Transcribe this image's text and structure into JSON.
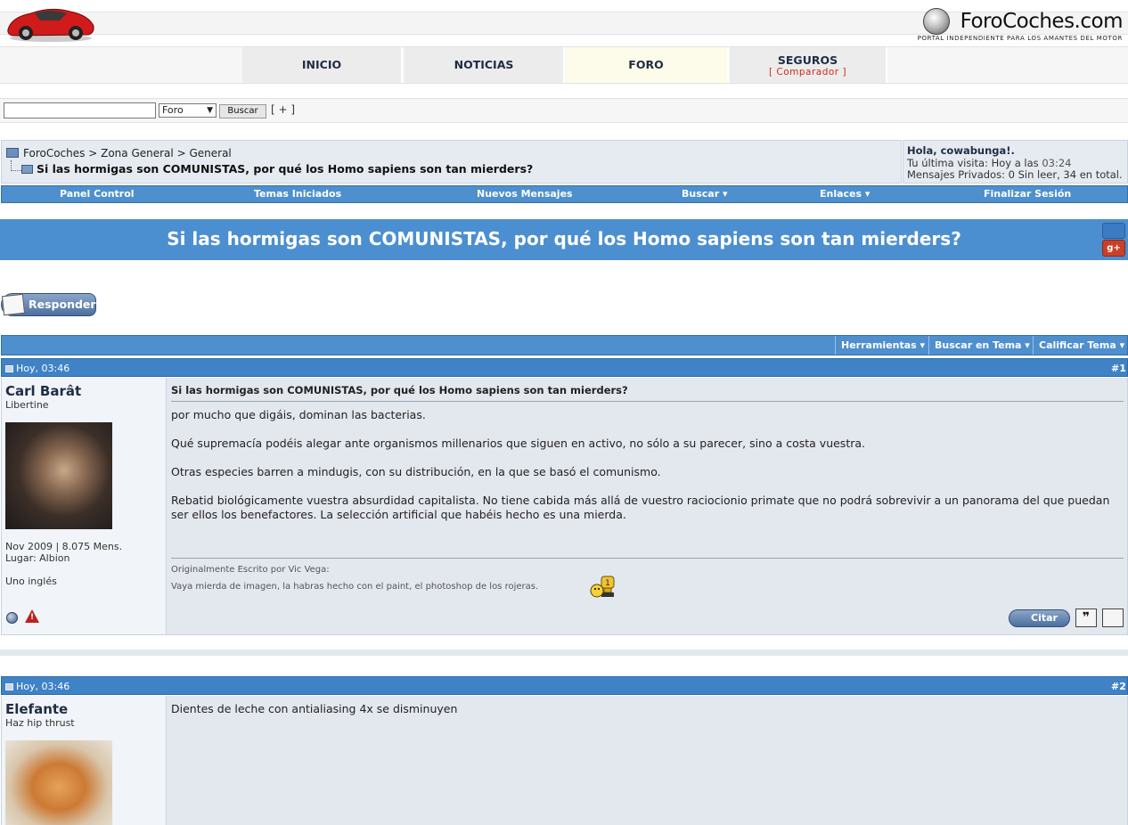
{
  "header": {
    "brand_name": "ForoCoches.com",
    "brand_tagline": "PORTAL INDEPENDIENTE PARA LOS AMANTES DEL MOTOR"
  },
  "nav": {
    "tabs": [
      {
        "label": "INICIO"
      },
      {
        "label": "NOTICIAS"
      },
      {
        "label": "FORO"
      },
      {
        "label": "SEGUROS",
        "sub": "[ Comparador ]"
      }
    ]
  },
  "search": {
    "query": "",
    "scope": "Foro",
    "button": "Buscar",
    "advanced": "[ + ]"
  },
  "breadcrumb": {
    "items": [
      "ForoCoches",
      "Zona General",
      "General"
    ],
    "separator": ">",
    "current": "Si las hormigas son COMUNISTAS, por qué los Homo sapiens son tan mierders?"
  },
  "user_panel": {
    "greeting": "Hola, cowabunga!.",
    "last_visit_prefix": "Tu última visita: Hoy a las",
    "last_visit_time": "03:24",
    "private_messages": "Mensajes Privados: 0 Sin leer, 34 en total."
  },
  "menubar": {
    "items": [
      {
        "label": "Panel Control"
      },
      {
        "label": "Temas Iniciados"
      },
      {
        "label": "Nuevos Mensajes"
      },
      {
        "label": "Buscar ▾"
      },
      {
        "label": "Enlaces ▾"
      },
      {
        "label": "Finalizar Sesión"
      }
    ]
  },
  "thread": {
    "title": "Si las hormigas son COMUNISTAS, por qué los Homo sapiens son tan mierders?",
    "reply_button": "Responder",
    "tools": [
      "Herramientas ▾",
      "Buscar en Tema ▾",
      "Calificar Tema ▾"
    ]
  },
  "posts": [
    {
      "date": "Hoy, 03:46",
      "number": "#1",
      "author": "Carl Barât",
      "author_title": "Libertine",
      "join_info": "Nov 2009 | 8.075 Mens.",
      "location": "Lugar: Albion",
      "extra": "Uno inglés",
      "subject": "Si las hormigas son COMUNISTAS, por qué los Homo sapiens son tan mierders?",
      "paragraphs": [
        "por mucho que digáis, dominan las bacterias.",
        "Qué supremacía podéis alegar ante organismos millenarios que siguen en activo, no sólo a su parecer, sino a costa vuestra.",
        "Otras especies barren a mindugis, con su distribución, en la que se basó el comunismo.",
        "Rebatid biológicamente vuestra absurdidad capitalista. No tiene cabida más allá de vuestro raciocionio primate que no podrá sobrevivir a un panorama del que puedan ser ellos los benefactores. La selección artificial que habéis hecho es una mierda."
      ],
      "signature_quote_by": "Originalmente Escrito por Vic Vega:",
      "signature_text": "Vaya mierda de imagen, la habras hecho con el paint, el photoshop de los rojeras.",
      "quote_button": "Citar",
      "multiquote_icon": "❞"
    },
    {
      "date": "Hoy, 03:46",
      "number": "#2",
      "author": "Elefante",
      "author_title": "Haz hip thrust",
      "body": "Dientes de leche con antialiasing 4x se disminuyen"
    }
  ],
  "colors": {
    "bar_blue": "#4e8fce",
    "post_head_blue": "#3f82c6",
    "post_body_bg": "#e3e7ee",
    "author_bg": "#f1f4f8",
    "link_red": "#d02b1c"
  }
}
